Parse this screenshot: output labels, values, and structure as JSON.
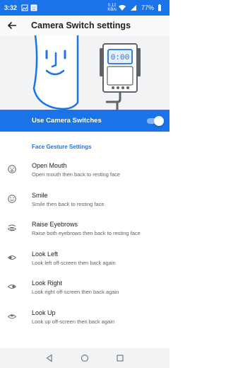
{
  "status": {
    "time": "3:32",
    "speed": "0.12\nKB/s",
    "battery": "77%"
  },
  "appbar": {
    "title": "Camera Switch settings"
  },
  "illustration": {
    "clock_text": "0:00"
  },
  "toggle": {
    "label": "Use Camera Switches",
    "on": true
  },
  "section": {
    "header": "Face Gesture Settings"
  },
  "gestures": [
    {
      "title": "Open Mouth",
      "desc": "Open mouth then back to resting face",
      "icon": "open-mouth-face-icon"
    },
    {
      "title": "Smile",
      "desc": "Smile then back to resting face",
      "icon": "smile-face-icon"
    },
    {
      "title": "Raise Eyebrows",
      "desc": "Raise both eyebrows then back to resting face",
      "icon": "raised-eyebrow-eye-icon"
    },
    {
      "title": "Look Left",
      "desc": "Look left off-screen then back again",
      "icon": "eye-look-left-icon"
    },
    {
      "title": "Look Right",
      "desc": "Look right off-screen then back again",
      "icon": "eye-look-right-icon"
    },
    {
      "title": "Look Up",
      "desc": "Look up off-screen then back again",
      "icon": "eye-look-up-icon"
    }
  ],
  "colors": {
    "accent": "#1a73e8",
    "illustration_bg": "#f1f3f4"
  }
}
